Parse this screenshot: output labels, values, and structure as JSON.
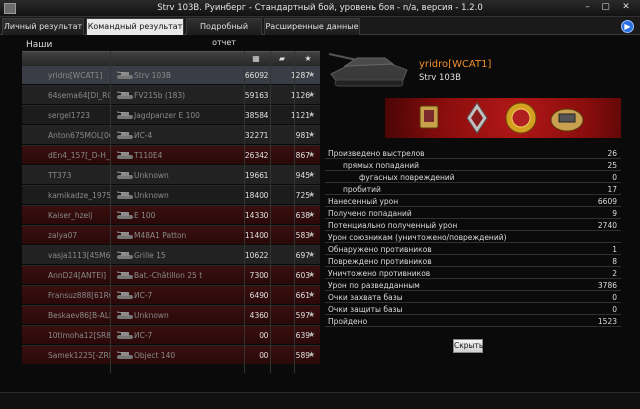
{
  "window": {
    "title": "Strv 103B. Руинберг - Стандартный бой, уровень боя - n/a, версия - 1.2.0",
    "minimize": "–",
    "maximize": "▢",
    "close": "✕"
  },
  "tabs": [
    {
      "label": "Личный результат"
    },
    {
      "label": "Командный результат"
    },
    {
      "label": "Подробный отчет"
    },
    {
      "label": "Расширенные данные"
    }
  ],
  "team_label": "Наши",
  "columns": {
    "player": "",
    "tank": "",
    "damage": "",
    "kills": "",
    "xp": ""
  },
  "rows": [
    {
      "player": "yridro[WCAT1]",
      "tank": "Strv 103B",
      "damage": "6609",
      "kills": "2",
      "xp": "1287"
    },
    {
      "player": "64sema64[DI_RO]",
      "tank": "FV215b (183)",
      "damage": "5916",
      "kills": "3",
      "xp": "1126"
    },
    {
      "player": "sergel1723",
      "tank": "Jagdpanzer E 100",
      "damage": "3858",
      "kills": "4",
      "xp": "1121"
    },
    {
      "player": "Anton675MOL[06",
      "tank": "ИС-4",
      "damage": "3227",
      "kills": "1",
      "xp": "981"
    },
    {
      "player": "dEn4_157[_D-H_]",
      "tank": "T110E4",
      "damage": "2634",
      "kills": "2",
      "xp": "867"
    },
    {
      "player": "TT373",
      "tank": "Unknown",
      "damage": "1966",
      "kills": "1",
      "xp": "945"
    },
    {
      "player": "kamikadze_1975_",
      "tank": "Unknown",
      "damage": "1840",
      "kills": "0",
      "xp": "725"
    },
    {
      "player": "Kaiser_hzelj",
      "tank": "E 100",
      "damage": "1433",
      "kills": "0",
      "xp": "638"
    },
    {
      "player": "zalya07",
      "tank": "M48A1 Patton",
      "damage": "1140",
      "kills": "0",
      "xp": "583"
    },
    {
      "player": "vasja1113[45M67",
      "tank": "Grille 15",
      "damage": "1062",
      "kills": "2",
      "xp": "697"
    },
    {
      "player": "AnnD24[ANTEI]",
      "tank": "Bat.-Châtillon 25 t",
      "damage": "730",
      "kills": "0",
      "xp": "603"
    },
    {
      "player": "Fransuz888[61RG",
      "tank": "ИС-7",
      "damage": "649",
      "kills": "0",
      "xp": "661"
    },
    {
      "player": "Beskaev86[B-ALL]",
      "tank": "Unknown",
      "damage": "436",
      "kills": "0",
      "xp": "597"
    },
    {
      "player": "10timoha12[SR88",
      "tank": "ИС-7",
      "damage": "0",
      "kills": "0",
      "xp": "639"
    },
    {
      "player": "Samek1225[-ZRD-]",
      "tank": "Object 140",
      "damage": "0",
      "kills": "0",
      "xp": "589"
    }
  ],
  "detail": {
    "player_name": "yridro[WCAT1]",
    "tank_name": "Strv 103B",
    "stats": [
      {
        "label": "Произведено выстрелов",
        "value": "26",
        "indent": 0
      },
      {
        "label": "прямых попаданий",
        "value": "25",
        "indent": 1
      },
      {
        "label": "фугасных повреждений",
        "value": "0",
        "indent": 2
      },
      {
        "label": "пробитий",
        "value": "17",
        "indent": 1
      },
      {
        "label": "Нанесенный урон",
        "value": "6609",
        "indent": 0
      },
      {
        "label": "Получено попаданий",
        "value": "9",
        "indent": 0
      },
      {
        "label": "Потенциально полученный урон",
        "value": "2740",
        "indent": 0
      },
      {
        "label": "Урон союзникам (уничтожено/повреждений)",
        "value": "",
        "indent": 0
      },
      {
        "label": "Обнаружено противников",
        "value": "1",
        "indent": 0
      },
      {
        "label": "Повреждено противников",
        "value": "8",
        "indent": 0
      },
      {
        "label": "Уничтожено противников",
        "value": "2",
        "indent": 0
      },
      {
        "label": "Урон по разведданным",
        "value": "3786",
        "indent": 0
      },
      {
        "label": "Очки захвата базы",
        "value": "0",
        "indent": 0
      },
      {
        "label": "Очки защиты базы",
        "value": "0",
        "indent": 0
      },
      {
        "label": "Пройдено",
        "value": "1523",
        "indent": 0
      }
    ],
    "copy_button": "Скрыть"
  },
  "colors": {
    "accent_orange": "#f08d2a",
    "dead_row": "#3a0f0f",
    "active_tab": "#e8e8e8",
    "medal_bg": "#b41818"
  }
}
